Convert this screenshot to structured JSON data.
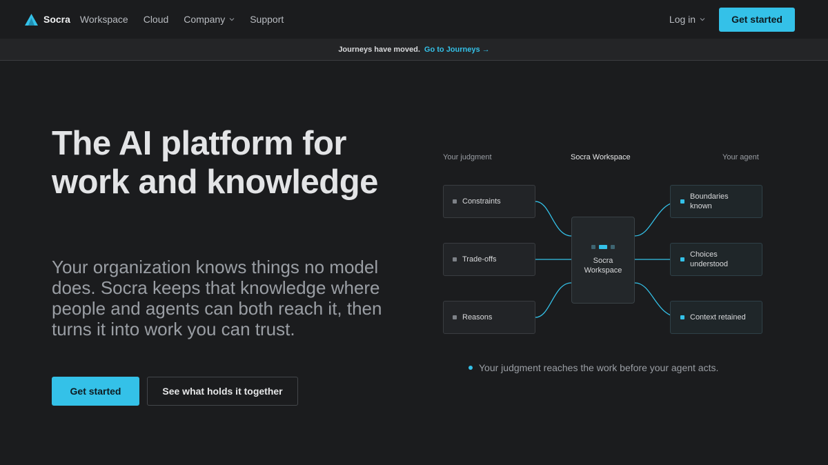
{
  "nav": {
    "brand": "Socra",
    "links": [
      "Workspace",
      "Cloud",
      "Company",
      "Support"
    ],
    "login": "Log in",
    "cta": "Get started"
  },
  "banner": {
    "text": "Journeys have moved.",
    "link": "Go to Journeys →"
  },
  "hero": {
    "title": "The AI platform for work and knowledge",
    "subtitle": "Your organization knows things no model does. Socra keeps that knowledge where people and agents can both reach it, then turns it into work you can trust.",
    "primary_cta": "Get started",
    "secondary_cta": "See what holds it together"
  },
  "diagram": {
    "left_label": "Your judgment",
    "center_label": "Socra Workspace",
    "right_label": "Your agent",
    "left_nodes": [
      "Constraints",
      "Trade-offs",
      "Reasons"
    ],
    "center_node": [
      "Socra",
      "Workspace"
    ],
    "right_nodes": [
      "Boundaries known",
      "Choices understood",
      "Context retained"
    ],
    "caption": "Your judgment reaches the work before your agent acts."
  },
  "colors": {
    "accent": "#34c1e8",
    "background": "#1b1c1e"
  }
}
